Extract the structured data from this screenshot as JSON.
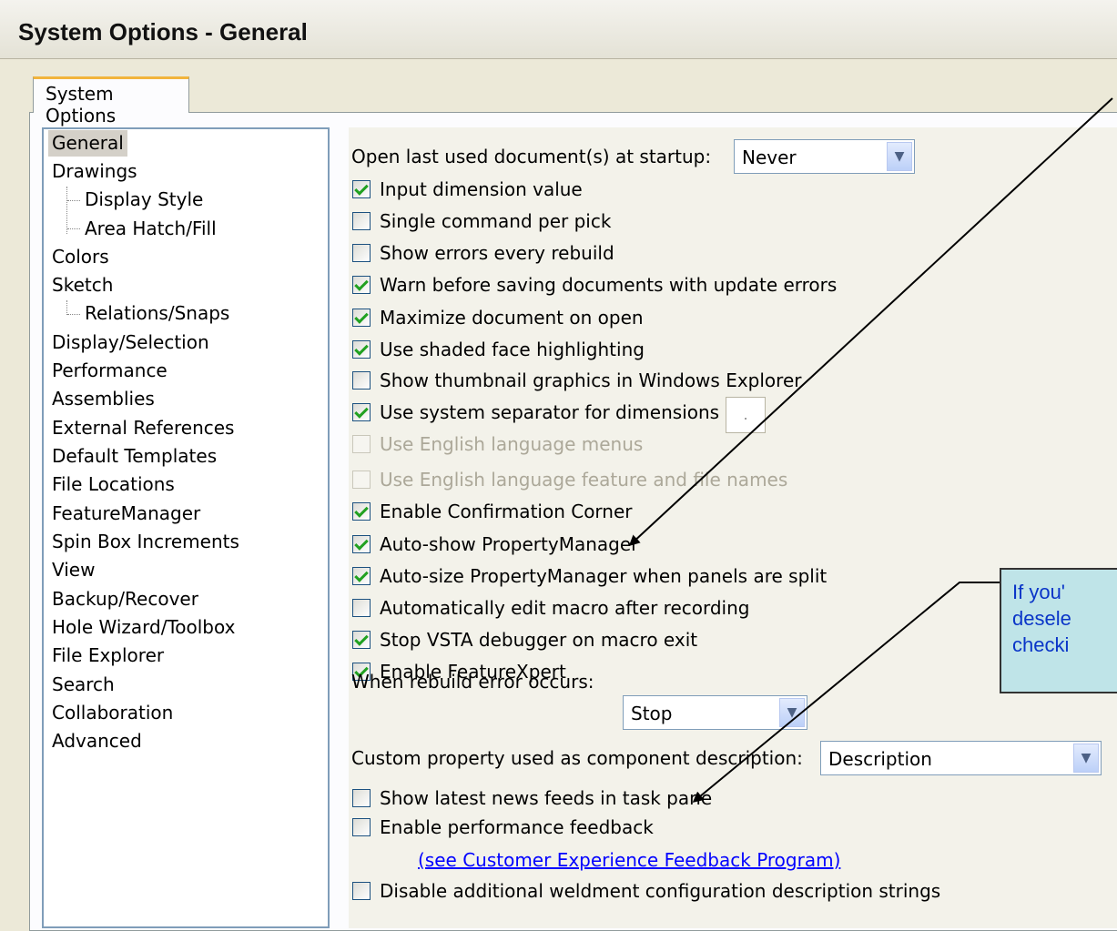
{
  "window": {
    "title": "System Options - General"
  },
  "tabs": [
    {
      "label": "System Options"
    }
  ],
  "tree": {
    "items": [
      {
        "label": "General"
      },
      {
        "label": "Drawings"
      },
      {
        "label": "Display Style"
      },
      {
        "label": "Area Hatch/Fill"
      },
      {
        "label": "Colors"
      },
      {
        "label": "Sketch"
      },
      {
        "label": "Relations/Snaps"
      },
      {
        "label": "Display/Selection"
      },
      {
        "label": "Performance"
      },
      {
        "label": "Assemblies"
      },
      {
        "label": "External References"
      },
      {
        "label": "Default Templates"
      },
      {
        "label": "File Locations"
      },
      {
        "label": "FeatureManager"
      },
      {
        "label": "Spin Box Increments"
      },
      {
        "label": "View"
      },
      {
        "label": "Backup/Recover"
      },
      {
        "label": "Hole Wizard/Toolbox"
      },
      {
        "label": "File Explorer"
      },
      {
        "label": "Search"
      },
      {
        "label": "Collaboration"
      },
      {
        "label": "Advanced"
      }
    ],
    "selected": "General"
  },
  "options": {
    "open_last_label": "Open last used document(s) at startup:",
    "open_last_value": "Never",
    "checkboxes": [
      {
        "label": "Input dimension value",
        "checked": true
      },
      {
        "label": "Single command per pick",
        "checked": false
      },
      {
        "label": "Show errors every rebuild",
        "checked": false
      },
      {
        "label": "Warn before saving documents with update errors",
        "checked": true
      },
      {
        "label": "Maximize document on open",
        "checked": true
      },
      {
        "label": "Use shaded face highlighting",
        "checked": true
      },
      {
        "label": "Show thumbnail graphics in Windows Explorer",
        "checked": false
      },
      {
        "label": "Use system separator for dimensions",
        "checked": true
      },
      {
        "label": "Use English language menus",
        "checked": false,
        "disabled": true
      },
      {
        "label": "Use English language feature and file names",
        "checked": false,
        "disabled": true
      },
      {
        "label": "Enable Confirmation Corner",
        "checked": true
      },
      {
        "label": "Auto-show PropertyManager",
        "checked": true
      },
      {
        "label": "Auto-size PropertyManager when panels are split",
        "checked": true
      },
      {
        "label": "Automatically edit macro after recording",
        "checked": false
      },
      {
        "label": "Stop VSTA debugger on macro exit",
        "checked": true
      },
      {
        "label": "Enable FeatureXpert",
        "checked": true
      }
    ],
    "separator_value": ".",
    "rebuild_error_label": "When rebuild error occurs:",
    "rebuild_error_value": "Stop",
    "custom_property_label": "Custom property used as component description:",
    "custom_property_value": "Description",
    "news_feeds_label": "Show latest news feeds in task pane",
    "news_feeds_checked": false,
    "perf_feedback_label": "Enable performance feedback",
    "perf_feedback_checked": false,
    "feedback_link": "(see Customer Experience Feedback Program)",
    "weldment_label": "Disable additional weldment configuration description strings",
    "weldment_checked": false
  },
  "callout": {
    "lines": [
      "If you'",
      "desele",
      "checki"
    ]
  }
}
